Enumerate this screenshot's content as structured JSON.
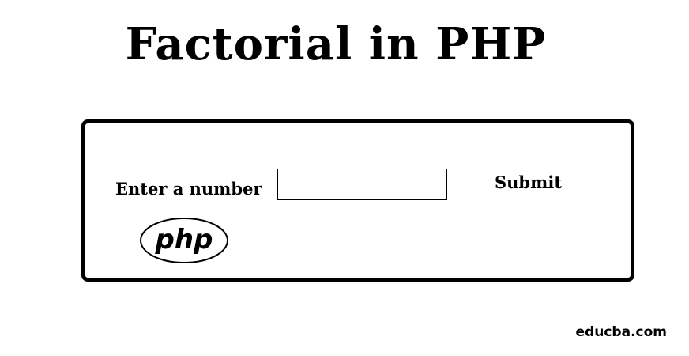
{
  "header": {
    "title": "Factorial in PHP"
  },
  "form": {
    "label": "Enter a number",
    "input_value": "",
    "input_placeholder": "",
    "submit_label": "Submit"
  },
  "logo": {
    "text": "php",
    "icon": "php-logo-icon"
  },
  "footer": {
    "watermark": "educba.com"
  },
  "colors": {
    "text": "#000000",
    "background": "#ffffff",
    "border": "#000000"
  }
}
